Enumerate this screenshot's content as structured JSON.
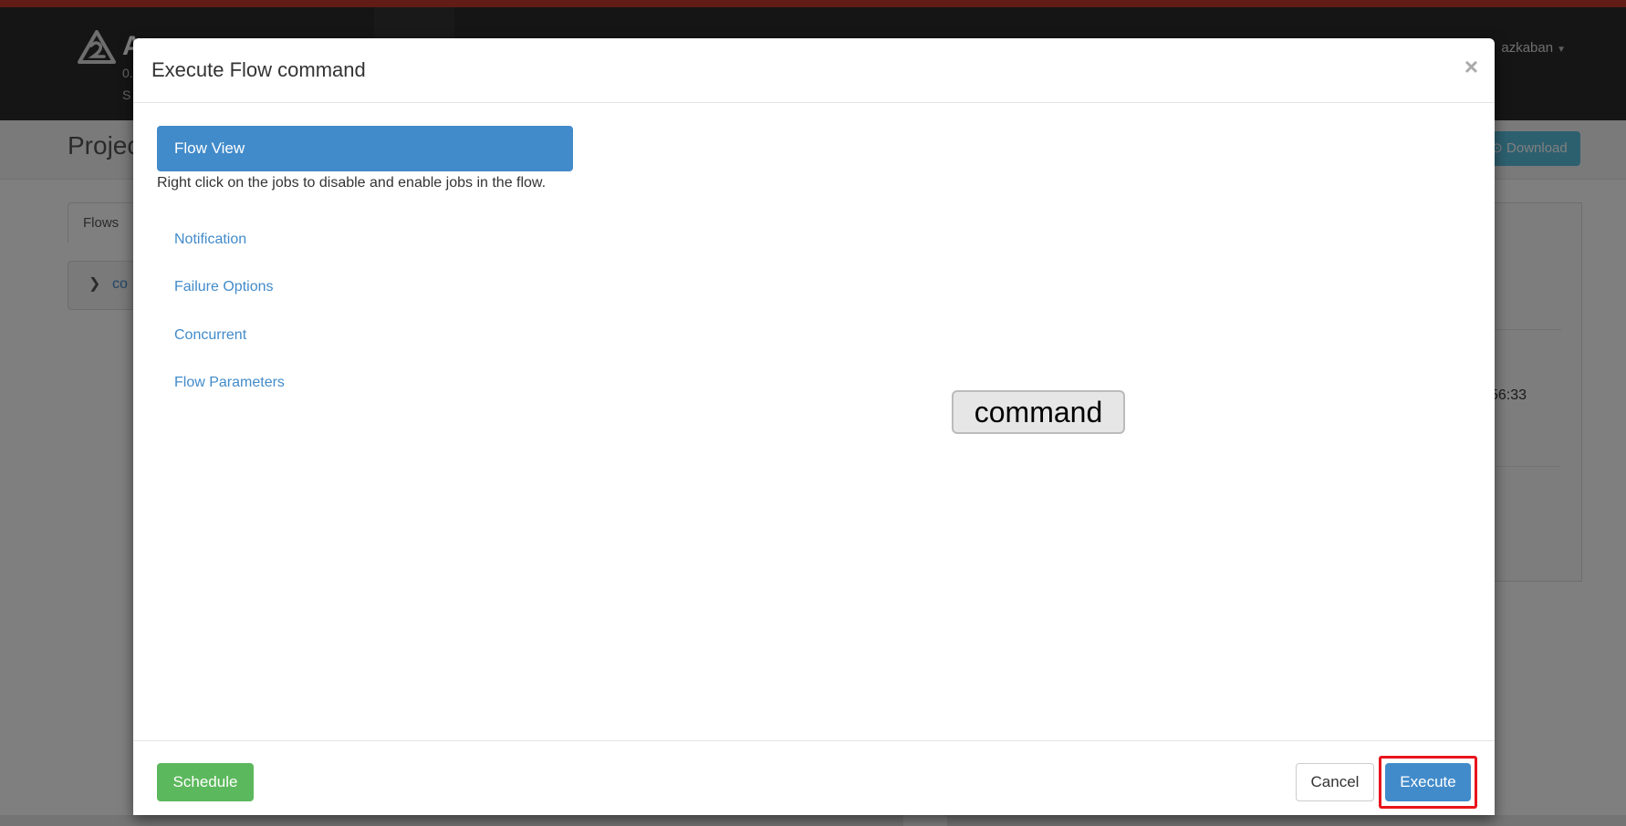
{
  "app": {
    "logo_text": "A",
    "logo_sub1": "0.",
    "logo_sub2": "S",
    "user": "azkaban"
  },
  "page": {
    "title": "Projec",
    "download_label": "Download",
    "flows_tab": "Flows",
    "flow_item": "co",
    "time_partial": "56:33"
  },
  "modal": {
    "title": "Execute Flow command",
    "close_label": "×",
    "flow_view_label": "Flow View",
    "flow_view_help": "Right click on the jobs to disable and enable jobs in the flow.",
    "side_links": [
      "Notification",
      "Failure Options",
      "Concurrent",
      "Flow Parameters"
    ],
    "graph_node": "command",
    "footer": {
      "schedule_label": "Schedule",
      "cancel_label": "Cancel",
      "execute_label": "Execute"
    }
  },
  "colors": {
    "primary": "#428bca",
    "success": "#5cb85c",
    "info": "#5bc0de",
    "highlight": "#e8141b",
    "navbar": "#2b2b2b",
    "accent": "#c0392b"
  }
}
